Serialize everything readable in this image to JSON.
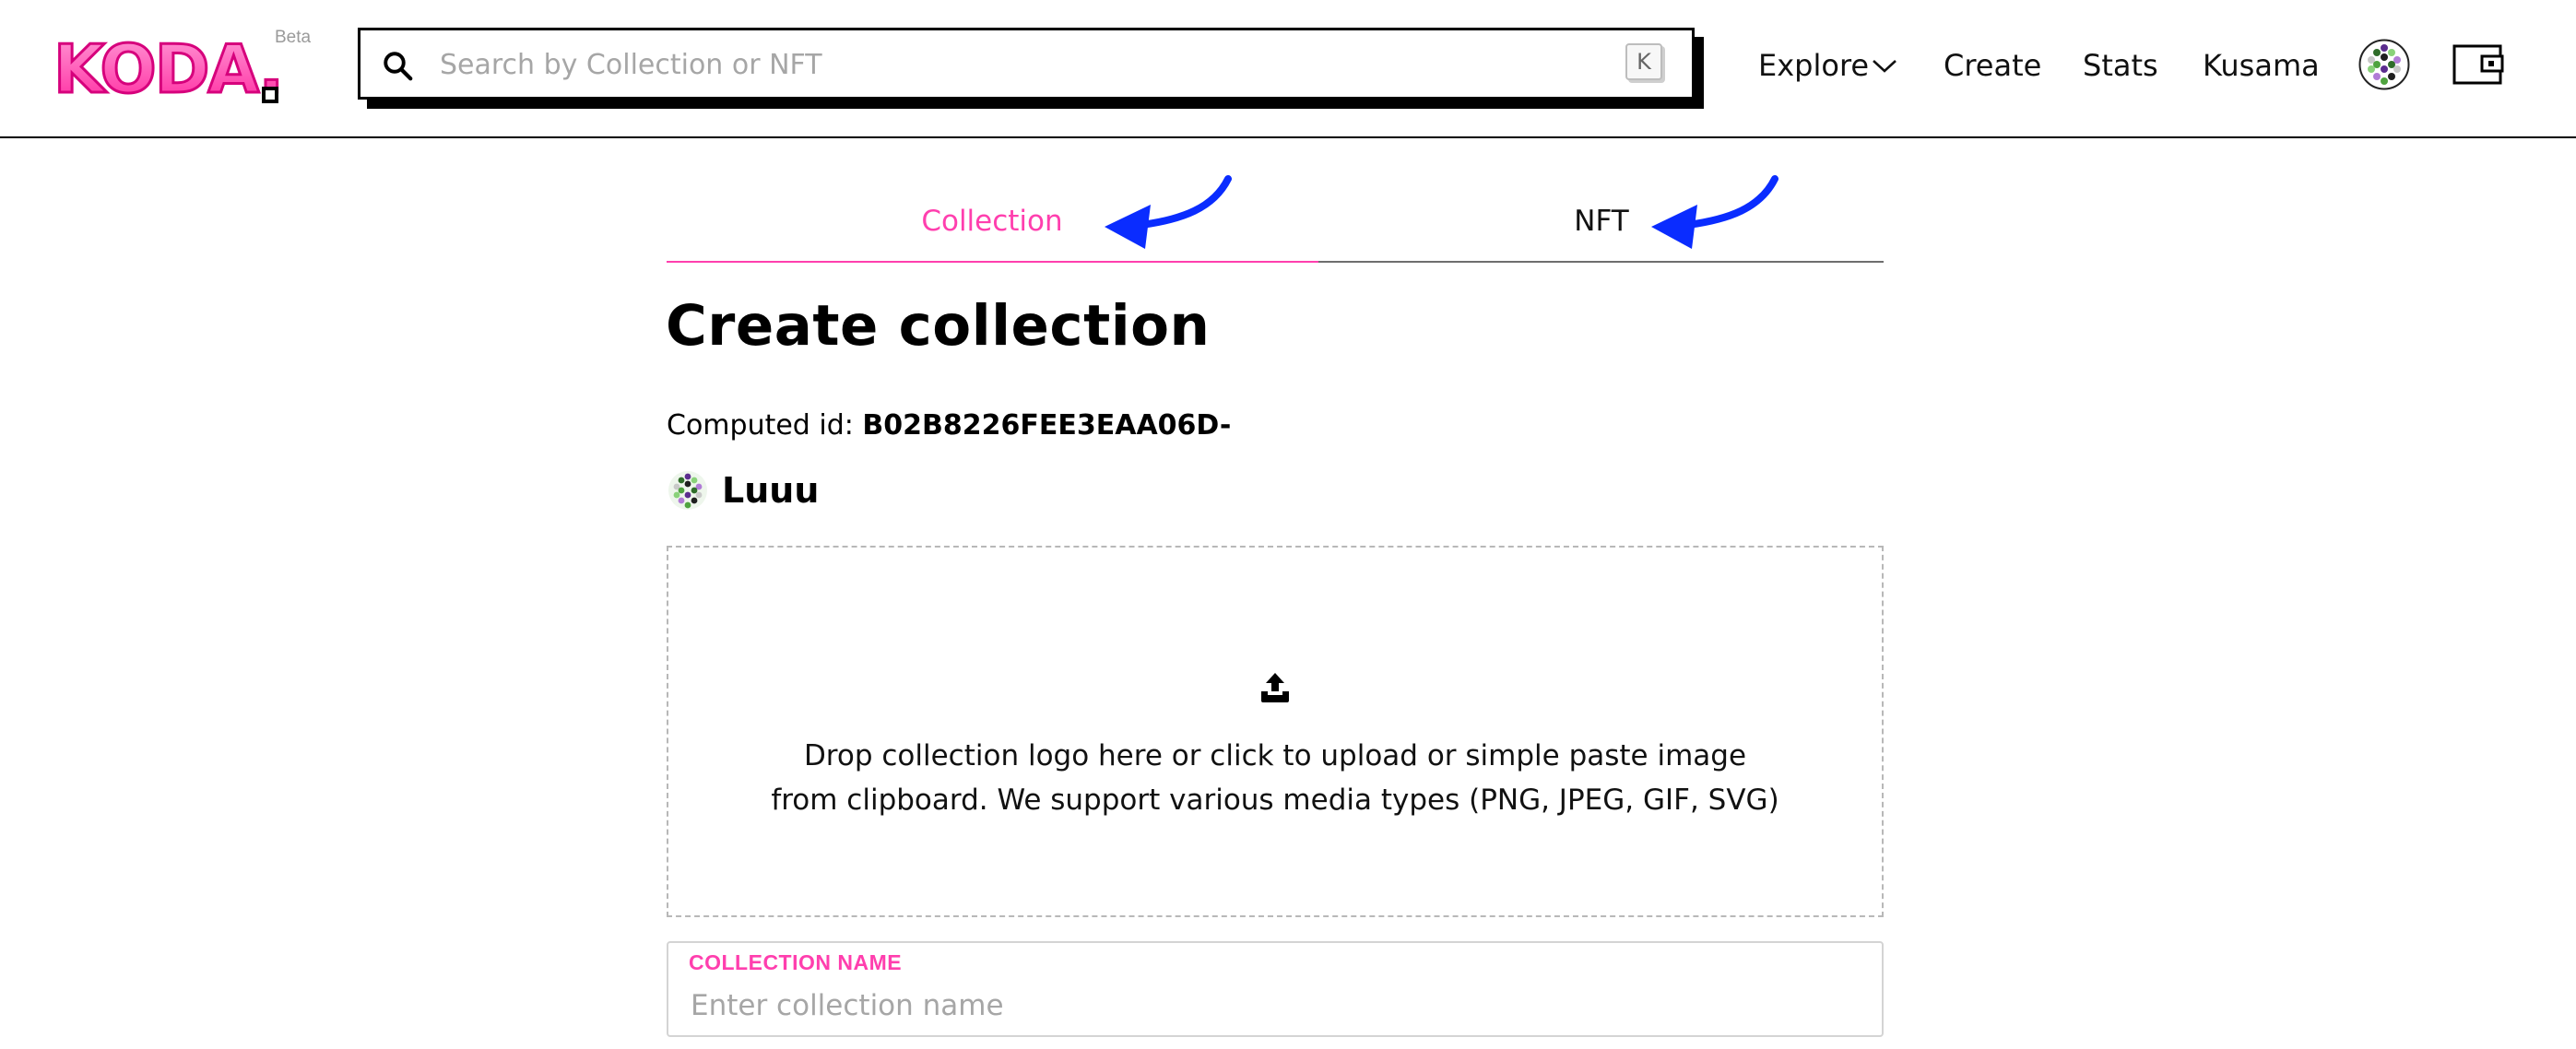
{
  "header": {
    "logo_text": "KODA.",
    "beta_label": "Beta",
    "search": {
      "placeholder": "Search by Collection or NFT",
      "value": "",
      "shortcut_key": "K"
    },
    "nav": {
      "explore": "Explore",
      "create": "Create",
      "stats": "Stats",
      "network": "Kusama"
    }
  },
  "tabs": [
    {
      "label": "Collection",
      "active": true
    },
    {
      "label": "NFT",
      "active": false
    }
  ],
  "main": {
    "title": "Create collection",
    "computed_id_label": "Computed id:",
    "computed_id_value": "B02B8226FEE3EAA06D-",
    "owner_name": "Luuu",
    "dropzone": {
      "line1": "Drop collection logo here or click to upload or simple paste image",
      "line2": "from clipboard. We support various media types (PNG, JPEG, GIF, SVG)"
    },
    "collection_name": {
      "label": "COLLECTION NAME",
      "placeholder": "Enter collection name",
      "value": ""
    }
  },
  "colors": {
    "accent_pink": "#ff3fae",
    "annotation_arrow": "#0a2cff",
    "text": "#111111"
  },
  "icons": [
    "koda-logo",
    "search-icon",
    "chevron-down-icon",
    "identicon-avatar",
    "wallet-icon",
    "upload-icon",
    "annotation-arrow"
  ]
}
